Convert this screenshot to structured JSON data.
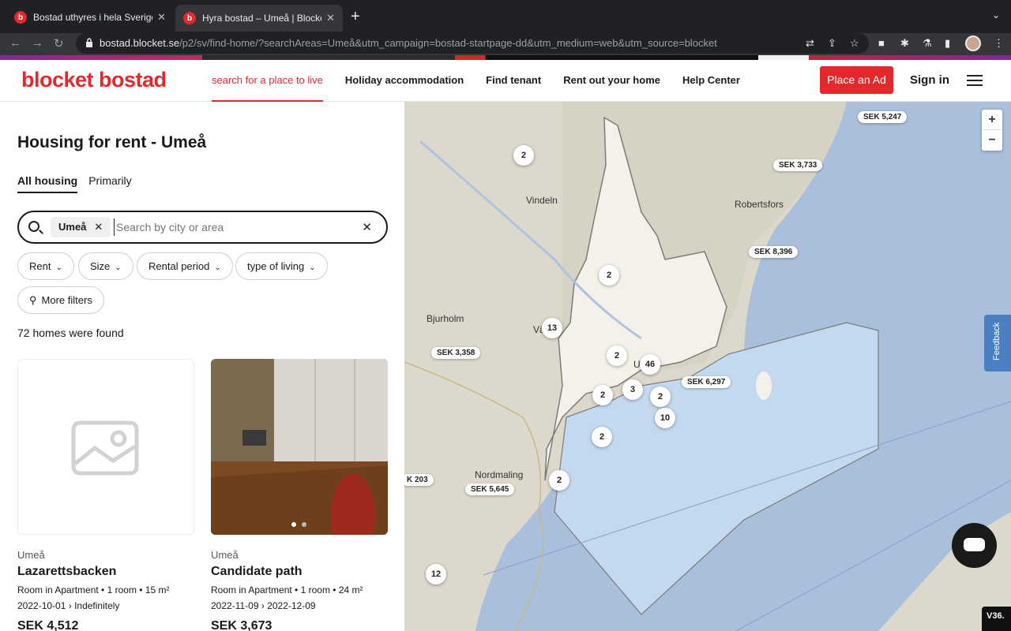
{
  "browser": {
    "tabs": [
      {
        "title": "Bostad uthyres i hela Sverige |",
        "favicon": "b",
        "active": false
      },
      {
        "title": "Hyra bostad – Umeå | Blocket B",
        "favicon": "b",
        "active": true
      }
    ],
    "url_domain": "bostad.blocket.se",
    "url_path": "/p2/sv/find-home/?searchAreas=Umeå&utm_campaign=bostad-startpage-dd&utm_medium=web&utm_source=blocket"
  },
  "header": {
    "logo": "blocket bostad",
    "nav": [
      "search for a place to live",
      "Holiday accommodation",
      "Find tenant",
      "Rent out your home",
      "Help Center"
    ],
    "place_ad": "Place an Ad",
    "sign_in": "Sign in"
  },
  "left": {
    "title": "Housing for rent - Umeå",
    "tabs": [
      "All housing",
      "Primarily"
    ],
    "search": {
      "chip": "Umeå",
      "placeholder": "Search by city or area"
    },
    "filters": [
      "Rent",
      "Size",
      "Rental period",
      "type of living",
      "More filters"
    ],
    "count": "72 homes were found",
    "listings": [
      {
        "city": "Umeå",
        "name": "Lazarettsbacken",
        "type": "Room in Apartment",
        "rooms": "1 room",
        "size": "15 m²",
        "from": "2022-10-01",
        "to": "Indefinitely",
        "price": "SEK 4,512"
      },
      {
        "city": "Umeå",
        "name": "Candidate path",
        "type": "Room in Apartment",
        "rooms": "1 room",
        "size": "24 m²",
        "from": "2022-11-09",
        "to": "2022-12-09",
        "price": "SEK 3,673"
      }
    ]
  },
  "map": {
    "labels": [
      "Vindeln",
      "Robertsfors",
      "Bjurholm",
      "Nordmaling",
      "Vä",
      "U"
    ],
    "price_tags": [
      "SEK 5,247",
      "SEK 3,733",
      "SEK 8,396",
      "SEK 3,358",
      "SEK 6,297",
      "K 203",
      "SEK 5,645"
    ],
    "clusters": [
      "2",
      "2",
      "13",
      "2",
      "46",
      "2",
      "3",
      "2",
      "10",
      "2",
      "2",
      "12"
    ],
    "zoom_in": "+",
    "zoom_out": "−",
    "feedback": "Feedback",
    "version": "V36."
  },
  "colors": {
    "brand": "#e3292e",
    "water": "#a9bfdb",
    "land": "#dcd8cc"
  }
}
